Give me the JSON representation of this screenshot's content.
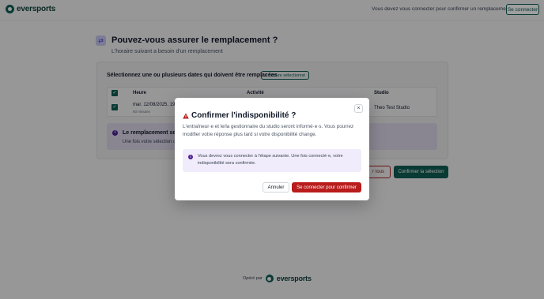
{
  "header": {
    "logo_text": "eversports",
    "message": "Vous devez vous connecter pour confirmer un remplacement",
    "login_button": "Se connecter"
  },
  "page": {
    "title": "Pouvez-vous assurer le remplacement ?",
    "subtitle": "L'horaire suivant a besoin d'un remplacement",
    "card_title": "Sélectionnez une ou plusieurs dates qui doivent être remplacées",
    "selected_badge": "1 horaire sélectionné",
    "table": {
      "headers": [
        "Heure",
        "Activité",
        "Studio"
      ],
      "row": {
        "time": "mar. 12/08/2025, 19:0",
        "duration": "60 minutes",
        "studio": "Theo Test Studio"
      }
    },
    "info_title": "Le remplacement sera",
    "info_text": "Une fois votre sélection co",
    "btn_all": "r tous",
    "btn_confirm": "Confirmer la sélection"
  },
  "footer": {
    "label": "Opéré par",
    "logo_text": "eversports"
  },
  "modal": {
    "title": "Confirmer l'indisponibilité ?",
    "description": "L'entraîneur·e et le/la gestionnaire du studio seront informé·e·s. Vous pourrez modifier votre réponse plus tard si votre disponibilité change.",
    "info": "Vous devrez vous connecter à l'étape suivante. Une fois connecté·e, votre indisponibilité sera confirmée.",
    "cancel": "Annuler",
    "confirm": "Se connecter pour confirmer",
    "close_symbol": "×"
  },
  "colors": {
    "brand": "#0f5e54",
    "danger": "#b91c1c",
    "info": "#4c1d95"
  }
}
